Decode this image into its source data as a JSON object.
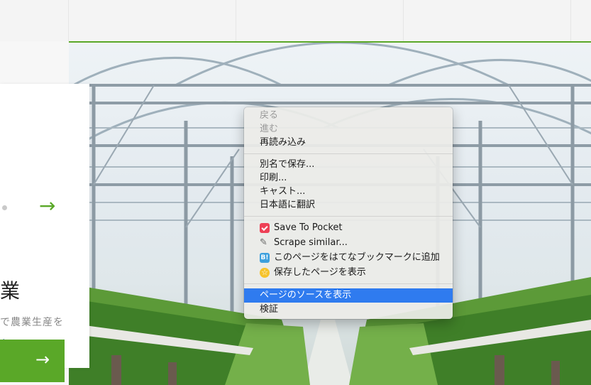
{
  "page": {
    "card": {
      "heading": "業",
      "desc_line1": "で農業生産を",
      "desc_line2": "ト",
      "arrow_top": "→",
      "cta_arrow": "→"
    }
  },
  "context_menu": {
    "items": [
      {
        "label": "戻る",
        "state": "disabled"
      },
      {
        "label": "進む",
        "state": "disabled"
      },
      {
        "label": "再読み込み",
        "state": "enabled"
      },
      {
        "label": "別名で保存...",
        "state": "enabled"
      },
      {
        "label": "印刷...",
        "state": "enabled"
      },
      {
        "label": "キャスト...",
        "state": "enabled"
      },
      {
        "label": "日本語に翻訳",
        "state": "enabled"
      },
      {
        "label": "Save To Pocket",
        "icon": "pocket-icon",
        "state": "enabled"
      },
      {
        "label": "Scrape similar...",
        "icon": "brush-icon",
        "state": "enabled"
      },
      {
        "label": "このページをはてなブックマークに追加",
        "icon": "hatena-bookmark-icon",
        "icon_text": "B!",
        "state": "enabled"
      },
      {
        "label": "保存したページを表示",
        "icon": "star-icon",
        "icon_text": "☆",
        "state": "enabled"
      },
      {
        "label": "ページのソースを表示",
        "state": "highlighted"
      },
      {
        "label": "検証",
        "state": "enabled"
      }
    ],
    "highlight_color": "#2f7bef"
  },
  "colors": {
    "accent_green": "#5aa828"
  }
}
